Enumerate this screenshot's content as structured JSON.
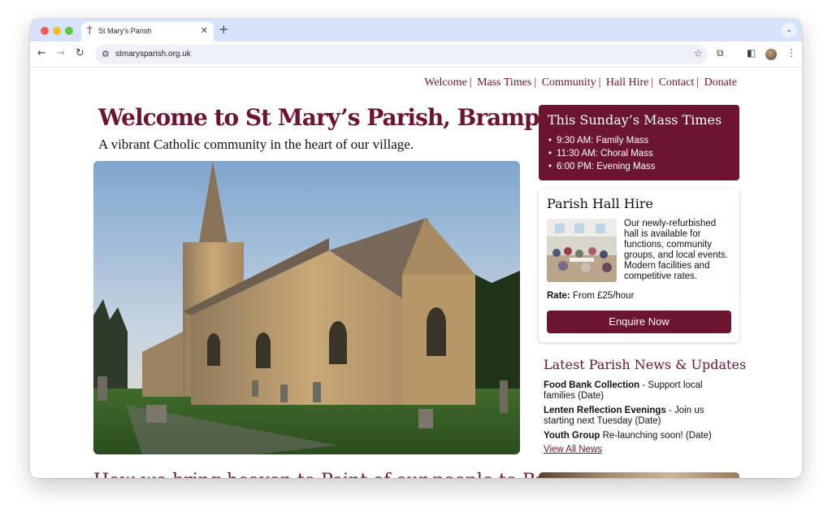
{
  "browser": {
    "tab_title": "St Mary's Parish",
    "tab_favicon": "cross-icon",
    "url": "stmarysparish.org.uk"
  },
  "nav": {
    "items": [
      "Welcome",
      "Mass Times",
      "Community",
      "Hall Hire",
      "Contact",
      "Donate"
    ]
  },
  "hero": {
    "title": "Welcome to St Mary’s Parish, Brampton",
    "subtitle": "A vibrant Catholic community in the heart of our village.",
    "image_icon": "church-photo"
  },
  "next_section_heading": "How we bring heaven to Point of our people to Bra",
  "mass_times": {
    "title": "This Sunday’s Mass Times",
    "items": [
      "9:30 AM: Family Mass",
      "11:30 AM: Choral Mass",
      "6:00 PM: Evening Mass"
    ]
  },
  "hall_hire": {
    "title": "Parish Hall Hire",
    "description": "Our newly-refurbished hall is available for functions, community groups, and local events. Modern facilities and competitive rates.",
    "rate_label": "Rate:",
    "rate_value": "From £25/hour",
    "button_label": "Enquire Now"
  },
  "news": {
    "title": "Latest Parish News & Updates",
    "items": [
      {
        "headline": "Food Bank Collection",
        "text": " - Support local families (Date)"
      },
      {
        "headline": "Lenten Reflection Evenings",
        "text": " - Join us starting next Tuesday (Date)"
      },
      {
        "headline": "Youth Group",
        "text": " Re-launching soon! (Date)"
      }
    ],
    "view_all": "View All News"
  },
  "colors": {
    "brand": "#6c1530",
    "tabbar": "#d7e3fb"
  }
}
